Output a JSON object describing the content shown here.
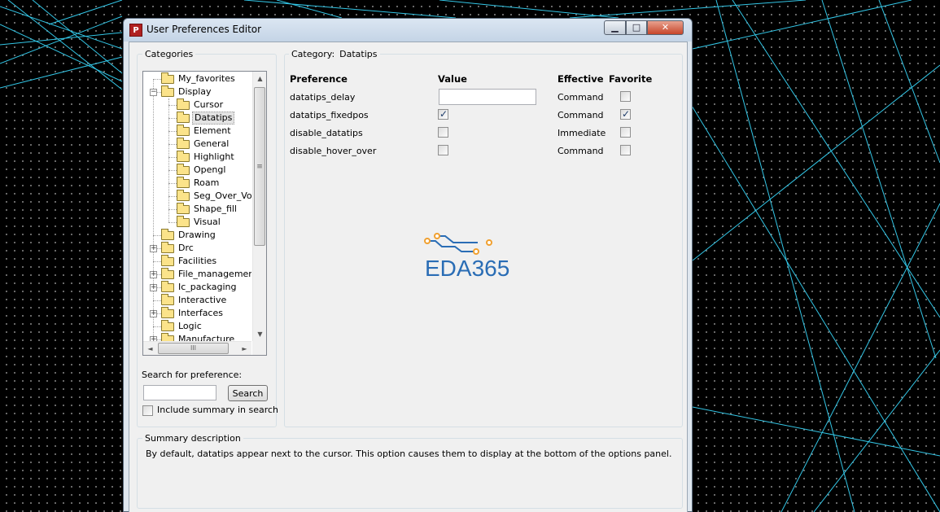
{
  "window": {
    "title": "User Preferences Editor",
    "icon": "app-icon",
    "controls": {
      "minimize": "▁",
      "maximize": "□",
      "close": "✕"
    }
  },
  "categories": {
    "group_label": "Categories",
    "items": [
      {
        "label": "My_favorites",
        "level": 0,
        "expander": ""
      },
      {
        "label": "Display",
        "level": 0,
        "expander": "−"
      },
      {
        "label": "Cursor",
        "level": 1,
        "expander": ""
      },
      {
        "label": "Datatips",
        "level": 1,
        "expander": "",
        "selected": true
      },
      {
        "label": "Element",
        "level": 1,
        "expander": ""
      },
      {
        "label": "General",
        "level": 1,
        "expander": ""
      },
      {
        "label": "Highlight",
        "level": 1,
        "expander": ""
      },
      {
        "label": "Opengl",
        "level": 1,
        "expander": ""
      },
      {
        "label": "Roam",
        "level": 1,
        "expander": ""
      },
      {
        "label": "Seg_Over_Voi",
        "level": 1,
        "expander": ""
      },
      {
        "label": "Shape_fill",
        "level": 1,
        "expander": ""
      },
      {
        "label": "Visual",
        "level": 1,
        "expander": ""
      },
      {
        "label": "Drawing",
        "level": 0,
        "expander": ""
      },
      {
        "label": "Drc",
        "level": 0,
        "expander": "+"
      },
      {
        "label": "Facilities",
        "level": 0,
        "expander": ""
      },
      {
        "label": "File_management",
        "level": 0,
        "expander": "+"
      },
      {
        "label": "Ic_packaging",
        "level": 0,
        "expander": "+"
      },
      {
        "label": "Interactive",
        "level": 0,
        "expander": ""
      },
      {
        "label": "Interfaces",
        "level": 0,
        "expander": "+"
      },
      {
        "label": "Logic",
        "level": 0,
        "expander": ""
      },
      {
        "label": "Manufacture",
        "level": 0,
        "expander": "+"
      }
    ],
    "scroll": {
      "up": "▲",
      "down": "▼",
      "left": "◄",
      "right": "►",
      "vgrip": "≡",
      "hgrip": "III"
    }
  },
  "search": {
    "label": "Search for preference:",
    "value": "",
    "button_label": "Search",
    "include_summary_label": "Include summary in search",
    "include_summary_checked": false
  },
  "category": {
    "label": "Category:",
    "name": "Datatips",
    "headers": {
      "preference": "Preference",
      "value": "Value",
      "effective": "Effective",
      "favorite": "Favorite"
    },
    "rows": [
      {
        "name": "datatips_delay",
        "value_type": "text",
        "value": "",
        "effective": "Command",
        "favorite": false
      },
      {
        "name": "datatips_fixedpos",
        "value_type": "checkbox",
        "value": true,
        "effective": "Command",
        "favorite": true
      },
      {
        "name": "disable_datatips",
        "value_type": "checkbox",
        "value": false,
        "effective": "Immediate",
        "favorite": false
      },
      {
        "name": "disable_hover_over",
        "value_type": "checkbox",
        "value": false,
        "effective": "Command",
        "favorite": false
      }
    ]
  },
  "watermark": {
    "text": "EDA365",
    "color": "#2a6db5",
    "accent": "#f0a030"
  },
  "summary": {
    "group_label": "Summary description",
    "text": "By default, datatips appear next to the cursor. This option causes them to display at the bottom of the options panel."
  }
}
